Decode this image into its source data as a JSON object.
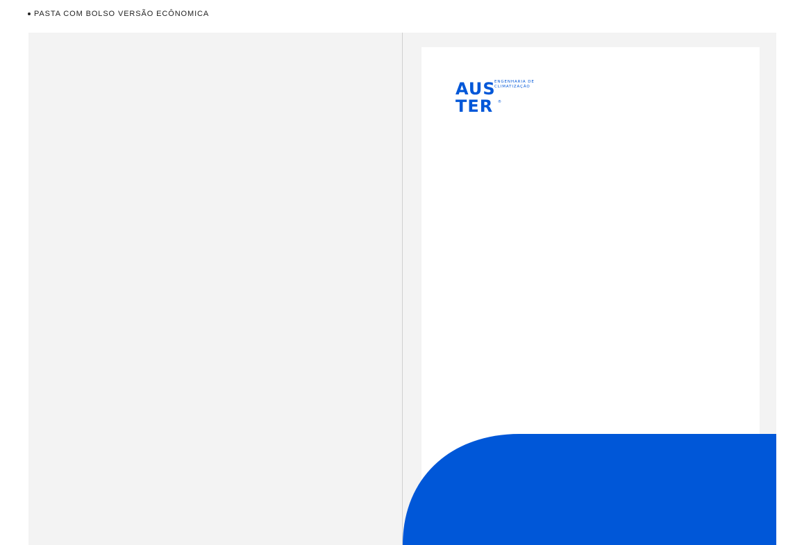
{
  "caption": {
    "text": "PASTA COM BOLSO VERSÃO ECÔNOMICA"
  },
  "logo": {
    "line1": "AUS",
    "line2": "TER",
    "registered": "®",
    "tagline_line1": "ENGENHARIA DE",
    "tagline_line2": "CLIMATIZAÇÃO"
  },
  "colors": {
    "brand_blue": "#0057d8",
    "folder_background": "#f3f3f3",
    "sheet_background": "#ffffff",
    "fold_line": "#cfcfcf"
  }
}
